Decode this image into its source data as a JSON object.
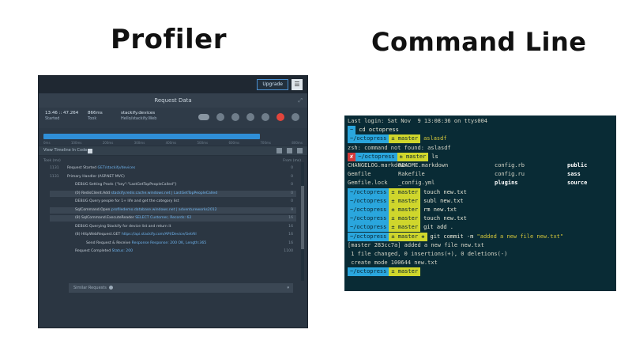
{
  "headings": {
    "profiler": "Profiler",
    "command_line": "Command Line"
  },
  "profiler": {
    "upgrade": "Upgrade",
    "menu_icon": "☰",
    "title": "Request Data",
    "expand_icon": "⤢",
    "stats": [
      {
        "value": "13:46 :: 47.264",
        "label": "Started"
      },
      {
        "value": "866ms",
        "label": "Took"
      },
      {
        "value": "stackify.devices",
        "label": "Hello/stackify.Web"
      }
    ],
    "timeline_ticks": [
      "0ms",
      "100ms",
      "200ms",
      "300ms",
      "400ms",
      "500ms",
      "600ms",
      "700ms",
      "800ms"
    ],
    "toolbar_label": "View Timeline In Code",
    "trace_head_left": "Took (ms)",
    "trace_head_right": "From (ms)",
    "rows": [
      {
        "time": "1131",
        "text": "Request Started",
        "link": "GET/stackify/devices",
        "num": "0"
      },
      {
        "time": "1131",
        "text": "Primary Handler (ASP.NET MVC)",
        "link": "",
        "num": "0"
      },
      {
        "time": "",
        "text": "DEBUG Setting Prods {\"key\":\"LastGetTopPeopleCalled\"}",
        "link": "",
        "num": "0"
      },
      {
        "time": "",
        "text": "(0) RedisClient.Add",
        "link": "stackify.redis.cache.windows.net | LastGetTopPeopleCalled",
        "num": "0"
      },
      {
        "time": "",
        "text": "DEBUG Query people for 1+ life and get the category list",
        "link": "",
        "num": "0"
      },
      {
        "time": "",
        "text": "SqlCommand.Open",
        "link": "profiledemo.database.windows.net | adventureworks2012",
        "num": "9"
      },
      {
        "time": "",
        "text": "(8) SqlCommand.ExecuteReader",
        "link": "SELECT Customer, Records: 62",
        "num": "16"
      },
      {
        "time": "",
        "text": "DEBUG Querying Stackify for device list and return it",
        "link": "",
        "num": "16"
      },
      {
        "time": "",
        "text": "(8) HttpWebRequest.GET",
        "link": "https://api.stackify.com/API/Device/GetAll",
        "num": "16"
      },
      {
        "time": "",
        "text": "Send Request & Receive",
        "link": "Response Response: 200 OK, Length:365",
        "num": "16"
      },
      {
        "time": "",
        "text": "Request Completed",
        "link": "Status: 200",
        "num": "1100"
      }
    ],
    "similar_requests": "Similar Requests"
  },
  "terminal": {
    "lines": [
      {
        "type": "text",
        "text": "Last login: Sat Nov  9 13:08:36 on ttys004"
      },
      {
        "type": "prompt",
        "dir": "~",
        "git": "",
        "cmd": "cd octopress"
      },
      {
        "type": "prompt",
        "dir": "~/octopress",
        "git": "± master",
        "cmd": "aslasdf",
        "bold": true
      },
      {
        "type": "text",
        "text": "zsh: command not found: aslasdf"
      },
      {
        "type": "errprompt",
        "err": "✘",
        "dir": "~/octopress",
        "git": "± master",
        "cmd": "ls"
      },
      {
        "type": "cols",
        "cols": [
          "CHANGELOG.markdown",
          "README.markdown",
          "config.rb",
          "public"
        ]
      },
      {
        "type": "cols",
        "cols": [
          "Gemfile",
          "Rakefile",
          "config.ru",
          "sass"
        ]
      },
      {
        "type": "cols",
        "cols": [
          "Gemfile.lock",
          "_config.yml",
          "plugins",
          "source"
        ]
      },
      {
        "type": "prompt",
        "dir": "~/octopress",
        "git": "± master",
        "cmd": "touch new.txt"
      },
      {
        "type": "prompt",
        "dir": "~/octopress",
        "git": "± master",
        "cmd": "subl new.txt"
      },
      {
        "type": "prompt",
        "dir": "~/octopress",
        "git": "± master",
        "cmd": "rm new.txt"
      },
      {
        "type": "prompt",
        "dir": "~/octopress",
        "git": "± master",
        "cmd": "touch new.txt"
      },
      {
        "type": "prompt",
        "dir": "~/octopress",
        "git": "± master",
        "cmd": "git add ."
      },
      {
        "type": "prompt",
        "dir": "~/octopress",
        "git": "± master ✚",
        "cmd": "git commit -m \"added a new file new.txt\""
      },
      {
        "type": "text",
        "text": "[master 283cc7a] added a new file new.txt"
      },
      {
        "type": "text",
        "text": " 1 file changed, 0 insertions(+), 0 deletions(-)"
      },
      {
        "type": "text",
        "text": " create mode 100644 new.txt"
      },
      {
        "type": "prompt",
        "dir": "~/octopress",
        "git": "± master",
        "cmd": ""
      }
    ]
  }
}
